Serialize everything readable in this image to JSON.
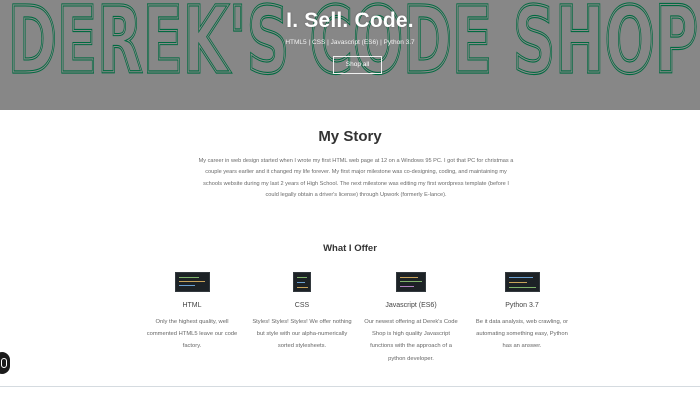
{
  "hero": {
    "banner_text": "DEREK'S CODE SHOP",
    "title": "I. Sell. Code.",
    "tagline": "HTML5 | CSS | Javascript (ES6) | Python 3.7",
    "shop_button": "Shop all"
  },
  "story": {
    "heading": "My Story",
    "body": "My career in web design started when I wrote my first HTML web page at 12 on a Windows 95 PC. I got that PC for christmas a couple years earlier and it changed my life forever. My first major milestone was co-designing, coding, and maintaining my schools website during my last 2 years of High School. The next milestone was editing my first wordpress template (before I could legally obtain a driver's license) through Upwork (formerly E-lance)."
  },
  "offer": {
    "heading": "What I Offer",
    "items": [
      {
        "name": "HTML",
        "description": "Only the highest quality, well commented HTML5 leave our code factory."
      },
      {
        "name": "CSS",
        "description": "Styles! Styles! Styles! We offer nothing but style with our alpha-numerically sorted stylesheets."
      },
      {
        "name": "Javascript (ES6)",
        "description": "Our newest offering at Derek's Code Shop is high quality Javascript functions with the approach of a python developer."
      },
      {
        "name": "Python 3.7",
        "description": "Be it data analysis, web crawling, or automating something easy, Python has an answer."
      }
    ]
  },
  "colors": {
    "hero_bg": "#878787",
    "banner_green": "#006a40",
    "text_dark": "#333333"
  },
  "icons": [
    "chat-widget-icon"
  ]
}
